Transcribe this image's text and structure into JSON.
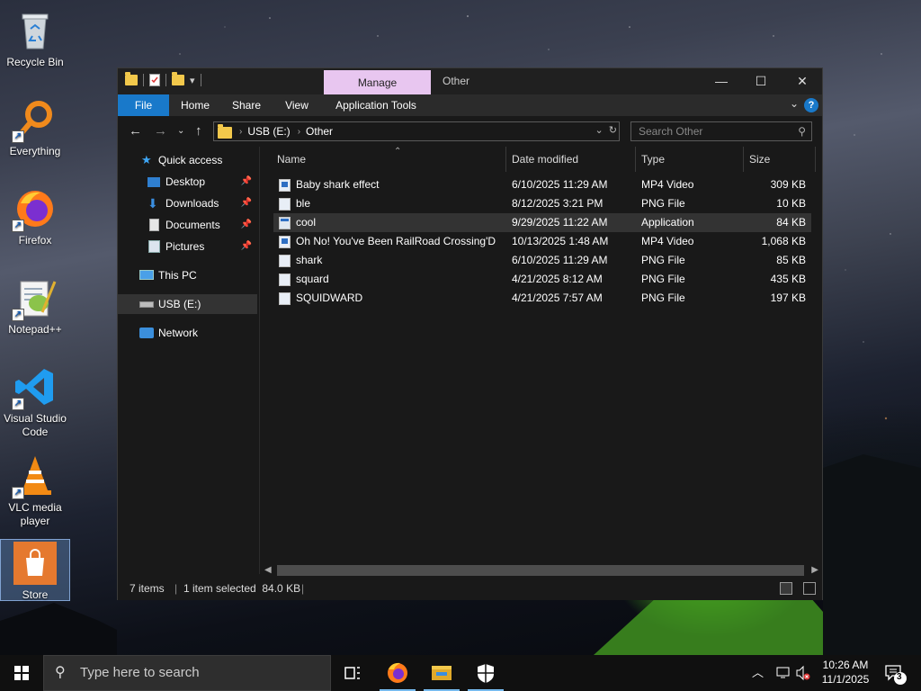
{
  "desktop": {
    "icons": [
      {
        "label": "Recycle Bin",
        "icon": "recycle-bin-icon"
      },
      {
        "label": "Everything",
        "icon": "everything-search-icon"
      },
      {
        "label": "Firefox",
        "icon": "firefox-icon"
      },
      {
        "label": "Notepad++",
        "icon": "notepadpp-icon"
      },
      {
        "label": "Visual Studio Code",
        "icon": "vscode-icon"
      },
      {
        "label": "VLC media player",
        "icon": "vlc-icon"
      },
      {
        "label": "Store",
        "icon": "store-icon"
      }
    ]
  },
  "window": {
    "contextual_tab": "Manage",
    "title": "Other",
    "controls": {
      "minimize": "—",
      "maximize": "☐",
      "close": "✕"
    },
    "ribbon_tabs": [
      "File",
      "Home",
      "Share",
      "View",
      "Application Tools"
    ],
    "address": {
      "drive": "USB (E:)",
      "folder": "Other"
    },
    "search_placeholder": "Search Other",
    "nav": {
      "quick_access": "Quick access",
      "pinned": [
        "Desktop",
        "Downloads",
        "Documents",
        "Pictures"
      ],
      "this_pc": "This PC",
      "usb": "USB (E:)",
      "network": "Network"
    },
    "columns": [
      "Name",
      "Date modified",
      "Type",
      "Size"
    ],
    "files": [
      {
        "name": "Baby shark effect",
        "date": "6/10/2025 11:29 AM",
        "type": "MP4 Video",
        "size": "309 KB",
        "kind": "video"
      },
      {
        "name": "ble",
        "date": "8/12/2025 3:21 PM",
        "type": "PNG File",
        "size": "10 KB",
        "kind": "png"
      },
      {
        "name": "cool",
        "date": "9/29/2025 11:22 AM",
        "type": "Application",
        "size": "84 KB",
        "kind": "app",
        "selected": true
      },
      {
        "name": "Oh No! You've Been RailRoad Crossing'D",
        "date": "10/13/2025 1:48 AM",
        "type": "MP4 Video",
        "size": "1,068 KB",
        "kind": "video"
      },
      {
        "name": "shark",
        "date": "6/10/2025 11:29 AM",
        "type": "PNG File",
        "size": "85 KB",
        "kind": "png"
      },
      {
        "name": "squard",
        "date": "4/21/2025 8:12 AM",
        "type": "PNG File",
        "size": "435 KB",
        "kind": "png"
      },
      {
        "name": "SQUIDWARD",
        "date": "4/21/2025 7:57 AM",
        "type": "PNG File",
        "size": "197 KB",
        "kind": "png"
      }
    ],
    "status": {
      "items": "7 items",
      "selection": "1 item selected  84.0 KB"
    }
  },
  "taskbar": {
    "search_placeholder": "Type here to search",
    "apps": [
      "task-view-icon",
      "firefox-icon",
      "file-explorer-icon",
      "security-shield-icon"
    ],
    "clock": {
      "time": "10:26 AM",
      "date": "11/1/2025"
    },
    "notifications": "3"
  },
  "colors": {
    "accent": "#1979ca",
    "manage_tab": "#e8c6f0",
    "window_bg": "#191919"
  }
}
